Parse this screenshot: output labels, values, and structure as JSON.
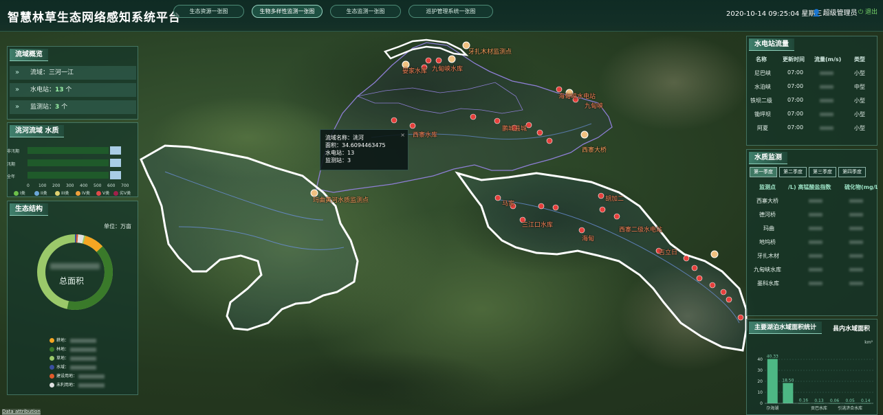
{
  "header": {
    "title": "智慧林草生态网络感知系统平台",
    "tabs": [
      {
        "label": "生态资源一张图"
      },
      {
        "label": "生物多样性监测一张图"
      },
      {
        "label": "生态监测一张图"
      },
      {
        "label": "巡护管理系统一张图"
      }
    ],
    "datetime": "2020-10-14 09:25:04 星期三",
    "user": "超级管理员",
    "logout": "退出"
  },
  "overview": {
    "title": "流域概览",
    "rows": [
      {
        "label": "流域：",
        "value": "三河一江",
        "unit": ""
      },
      {
        "label": "水电站：",
        "value": "13",
        "unit": "个"
      },
      {
        "label": "监测站：",
        "value": "3",
        "unit": "个"
      }
    ]
  },
  "water_quality_chart": {
    "title": "洮河流域 水质",
    "categories": [
      "非汛期",
      "汛期",
      "全年"
    ],
    "ticks": [
      "0",
      "100",
      "200",
      "300",
      "400",
      "500",
      "600",
      "700"
    ],
    "legend": [
      {
        "label": "I类",
        "color": "#6cc04a"
      },
      {
        "label": "II类",
        "color": "#6aa6d8"
      },
      {
        "label": "III类",
        "color": "#e0d070"
      },
      {
        "label": "IV类",
        "color": "#f0a03c"
      },
      {
        "label": "V类",
        "color": "#e04a4a"
      },
      {
        "label": "劣V类",
        "color": "#a0204a"
      }
    ]
  },
  "eco_structure": {
    "title": "生态结构",
    "unit_label": "单位：万亩",
    "center_label": "总面积",
    "legend": [
      {
        "label": "耕地：",
        "color": "#f5a623"
      },
      {
        "label": "林地：",
        "color": "#3a7a2a"
      },
      {
        "label": "草地：",
        "color": "#9bc96a"
      },
      {
        "label": "水域：",
        "color": "#3a4fa0"
      },
      {
        "label": "建设用地：",
        "color": "#e05a2a"
      },
      {
        "label": "未利用地：",
        "color": "#e0e0e0"
      }
    ]
  },
  "popup": {
    "lines": [
      "流域名称：洮河",
      "面积：34.6094463475",
      "水电站：13",
      "监测站：3"
    ],
    "close": "×"
  },
  "map_labels": [
    "牙扎木材监测点",
    "晏家水库",
    "九甸峡水库",
    "西寨大桥",
    "玛曲黄河水质监测点",
    "海甸峡水电站",
    "九甸峡",
    "西寨水库",
    "鹏城县城",
    "三江口水库",
    "马家",
    "海甸",
    "吉立日",
    "胡加二",
    "西寨二级水电站"
  ],
  "hydro_flow": {
    "title": "水电站流量",
    "headers": [
      "名称",
      "更新时间",
      "流量(m/s)",
      "类型"
    ],
    "rows": [
      {
        "name": "尼巴峡",
        "time": "07:00",
        "type": "小型"
      },
      {
        "name": "水泊峡",
        "time": "07:00",
        "type": "中型"
      },
      {
        "name": "铁坝二级",
        "time": "07:00",
        "type": "小型"
      },
      {
        "name": "锄坪坝",
        "time": "07:00",
        "type": "小型"
      },
      {
        "name": "阿夏",
        "time": "07:00",
        "type": "小型"
      }
    ]
  },
  "water_monitor": {
    "title": "水质监测",
    "quarters": [
      "第一季度",
      "第二季度",
      "第三季度",
      "第四季度"
    ],
    "headers": [
      "监测点",
      "/L) 高锰酸盐指数",
      "硫化物(mg/L)"
    ],
    "stations": [
      "西寨大桥",
      "德河桥",
      "玛曲",
      "地坞桥",
      "牙扎木材",
      "九甸峡水库",
      "墨科水库"
    ]
  },
  "lake_area": {
    "title_a": "主要湖泊水域面积统计",
    "title_b": "县内水域面积",
    "unit": "km²",
    "chart_data": {
      "type": "bar",
      "yticks": [
        "40",
        "30",
        "20",
        "10",
        "0"
      ],
      "ylim": [
        0,
        45
      ],
      "values": [
        40.33,
        18.5,
        0.16,
        0.13,
        0.06,
        0.05,
        0.14
      ],
      "value_labels": [
        "40.33",
        "18.50",
        "0.16",
        "0.13",
        "0.06",
        "0.05",
        "0.14"
      ],
      "xlabels": [
        "尕海湖",
        "",
        "",
        "贡巴水库",
        "",
        "引洮济合水库",
        ""
      ]
    }
  },
  "attribution": "Data attribution",
  "colors": {
    "accent": "#8fd0bb",
    "panel_bg": "#12342a",
    "bar_green": "#4db784",
    "marker_red": "#e5403c"
  }
}
